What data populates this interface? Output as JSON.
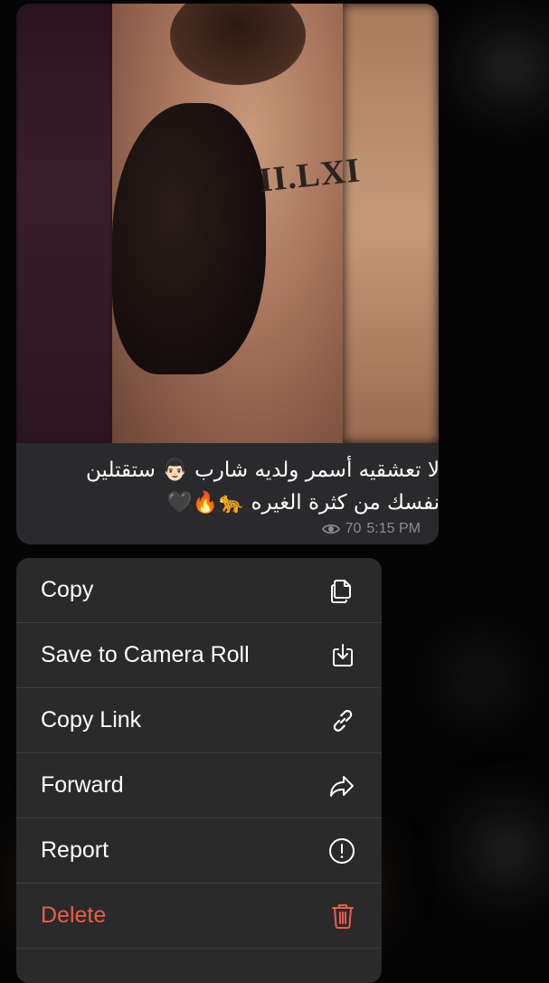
{
  "message": {
    "caption_line1": "لا تعشقيه أسمر ولديه شارب 👨🏻 ستقتلين",
    "caption_line2": "نفسك من كثرة الغيره 🐆🔥🖤",
    "views": "70",
    "time": "5:15 PM",
    "photo_tattoo": "II.LXI"
  },
  "menu": {
    "items": [
      {
        "label": "Copy",
        "icon": "copy-icon"
      },
      {
        "label": "Save to Camera Roll",
        "icon": "download-icon"
      },
      {
        "label": "Copy Link",
        "icon": "link-icon"
      },
      {
        "label": "Forward",
        "icon": "share-arrow-icon"
      },
      {
        "label": "Report",
        "icon": "report-icon"
      },
      {
        "label": "Delete",
        "icon": "trash-icon",
        "color": "#ec5d4b"
      }
    ]
  }
}
